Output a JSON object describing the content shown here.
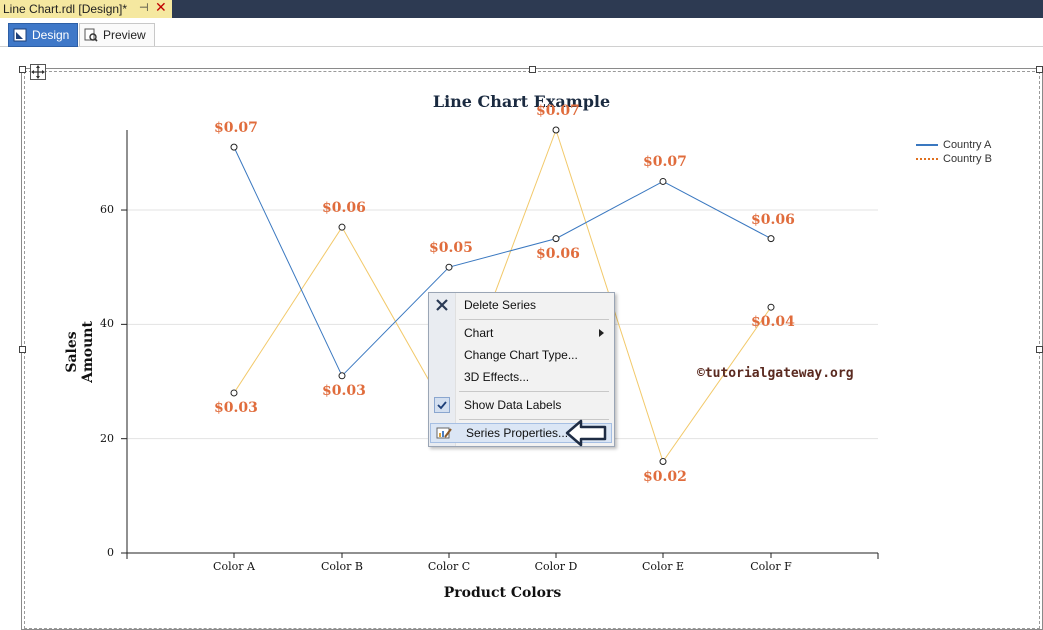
{
  "document": {
    "tab_title": "Line Chart.rdl [Design]*",
    "pin_glyph": "⊣",
    "close_glyph": "✕"
  },
  "view_tabs": [
    {
      "label": "Design",
      "icon": "design-icon",
      "active": true
    },
    {
      "label": "Preview",
      "icon": "preview-icon",
      "active": false
    }
  ],
  "chart_data": {
    "type": "line",
    "title": "Line Chart Example",
    "xlabel": "Product Colors",
    "ylabel": "Sales Amount",
    "categories": [
      "Color A",
      "Color B",
      "Color C",
      "Color D",
      "Color E",
      "Color F"
    ],
    "yticks": [
      "0",
      "20",
      "40",
      "60"
    ],
    "ylim": [
      0,
      74
    ],
    "grid": true,
    "legend_position": "top-right",
    "series": [
      {
        "name": "Country A",
        "color": "#3a78c0",
        "values": [
          71,
          31,
          50,
          55,
          65,
          55
        ],
        "labels": [
          "$0.07",
          "$0.03",
          "$0.05",
          "$0.06",
          "$0.07",
          "$0.06"
        ]
      },
      {
        "name": "Country B",
        "color": "#f2c96a",
        "values": [
          28,
          57,
          24,
          74,
          16,
          43
        ],
        "labels": [
          "$0.03",
          "$0.06",
          "",
          "$0.07",
          "$0.02",
          "$0.04"
        ]
      }
    ]
  },
  "watermark": "©tutorialgateway.org",
  "context_menu": {
    "items": [
      {
        "label": "Delete Series",
        "icon": "delete-icon"
      },
      {
        "label": "Chart",
        "icon": "",
        "submenu": true
      },
      {
        "label": "Change Chart Type...",
        "icon": ""
      },
      {
        "label": "3D Effects...",
        "icon": ""
      },
      {
        "label": "Show Data Labels",
        "icon": "checkmark-icon",
        "checked": true
      },
      {
        "label": "Series Properties...",
        "icon": "series-properties-icon",
        "highlighted": true
      }
    ]
  }
}
